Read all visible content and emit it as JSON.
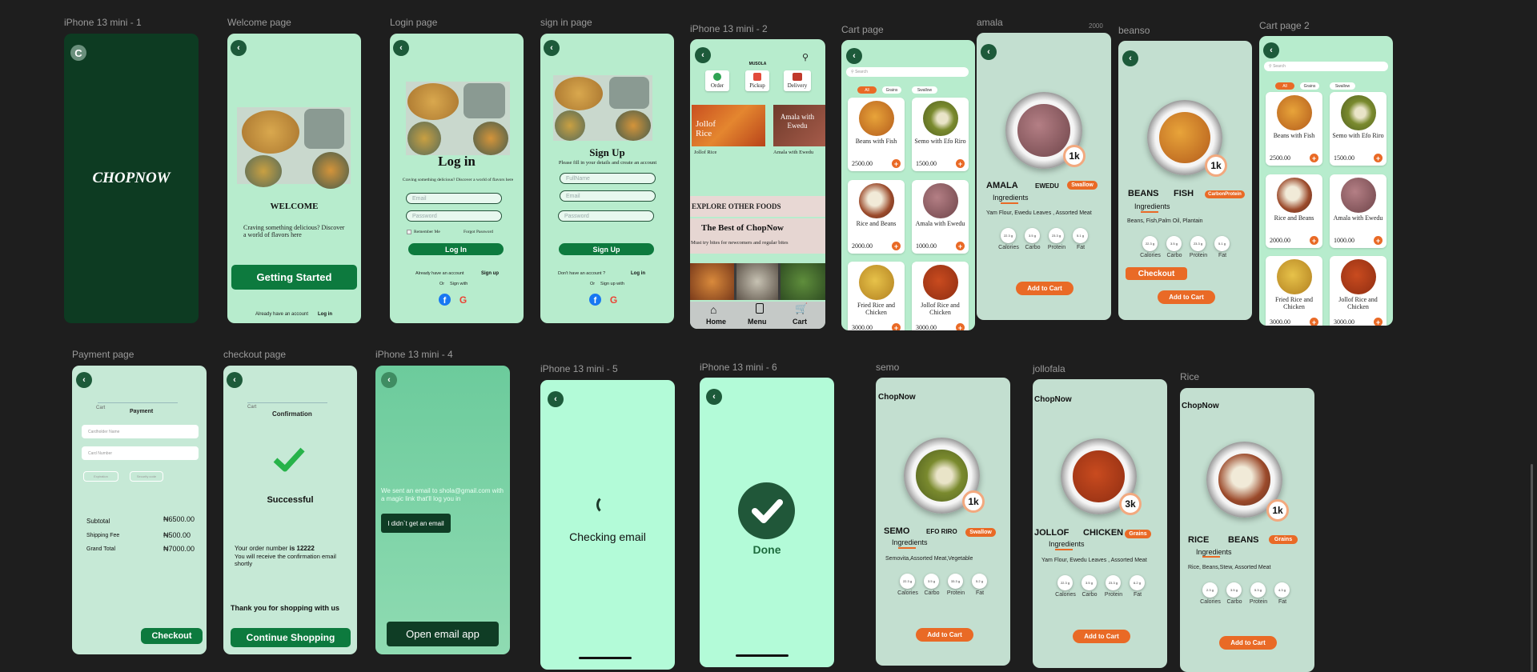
{
  "frames": {
    "splash": {
      "label": "iPhone 13 mini - 1",
      "brand": "CHOPNOW",
      "logo_letter": "C"
    },
    "welcome": {
      "label": "Welcome page",
      "title": "WELCOME",
      "text": "Craving something delicious? Discover a world of flavors  here",
      "cta": "Getting Started",
      "footer_a": "Already have an account",
      "footer_b": "Log in"
    },
    "login": {
      "label": "Login page",
      "title": "Log in",
      "subtitle": "Craving something delicious? Discover a world of flavors here",
      "email_ph": "Email",
      "password_ph": "Password",
      "remember": "Remember Me",
      "forgot": "Forgot Password",
      "button": "Log In",
      "have_account": "Already have an account",
      "signup": "Sign up",
      "or": "Or",
      "sign_with": "Sign with"
    },
    "signin": {
      "label": "sign in page",
      "title": "Sign Up",
      "subtitle": "Please fill in your details and create an account",
      "fullname_ph": "FullName",
      "email_ph": "Email",
      "password_ph": "Password",
      "button": "Sign Up",
      "no_account": "Don't have an account ?",
      "login": "Log in",
      "or": "Or",
      "sign_with": "Sign up with"
    },
    "home": {
      "label": "iPhone 13 mini - 2",
      "brand": "MUSOLA",
      "nav": [
        "Order",
        "Pickup",
        "Delivery"
      ],
      "featured": [
        {
          "name": "Jollof Rice",
          "overlay": "Jollof Rice"
        },
        {
          "name": "Amala with Ewedu",
          "overlay": "Amala with Ewedu"
        }
      ],
      "explore": "EXPLORE OTHER FOODS",
      "best_title": "The Best of ChopNow",
      "best_sub": "Must try bites for newcomers and regular bites",
      "tabs": [
        "Home",
        "Menu",
        "Cart"
      ]
    },
    "cart": {
      "label": "Cart page",
      "search_ph": "Search",
      "chips": [
        "All",
        "Grains",
        "Swallow"
      ],
      "items": [
        {
          "name": "Beans with Fish",
          "price": "2500.00"
        },
        {
          "name": "Semo with Efo Riro",
          "price": "1500.00"
        },
        {
          "name": "Rice and Beans",
          "price": "2000.00"
        },
        {
          "name": "Amala with Ewedu",
          "price": "1000.00"
        },
        {
          "name": "Fried Rice and Chicken",
          "price": "3000.00"
        },
        {
          "name": "Jollof Rice and Chicken",
          "price": "3000.00"
        }
      ]
    },
    "amala": {
      "label": "amala",
      "name_a": "AMALA",
      "name_b": "EWEDU",
      "tag": "Swallow",
      "badge": "1k",
      "ingredients_title": "Ingredients",
      "ingredients": "Yam Flour, Ewedu Leaves , Assorted Meat",
      "nutrition": [
        {
          "label": "Calories",
          "value": "22.3 g"
        },
        {
          "label": "Carbo",
          "value": "3.5 g"
        },
        {
          "label": "Protein",
          "value": "23.3 g"
        },
        {
          "label": "Fat",
          "value": "5.1 g"
        }
      ],
      "button": "Add to Cart",
      "extra": "2000"
    },
    "beanso": {
      "label": "beanso",
      "name_a": "BEANS",
      "name_b": "FISH",
      "tag": "CarbonProtein",
      "badge": "1k",
      "ingredients_title": "Ingredients",
      "ingredients": "Beans, Fish,Palm Oil, Plantain",
      "nutrition": [
        {
          "label": "Calories",
          "value": "22.3 g"
        },
        {
          "label": "Carbo",
          "value": "3.5 g"
        },
        {
          "label": "Protein",
          "value": "23.3 g"
        },
        {
          "label": "Fat",
          "value": "5.1 g"
        }
      ],
      "checkout": "Checkout",
      "button": "Add to Cart"
    },
    "cart2": {
      "label": "Cart page 2",
      "search_ph": "Search",
      "chips": [
        "All",
        "Grains",
        "Swallow"
      ],
      "items": [
        {
          "name": "Beans with Fish",
          "price": "2500.00"
        },
        {
          "name": "Semo with Efo Riro",
          "price": "1500.00"
        },
        {
          "name": "Rice and Beans",
          "price": "2000.00"
        },
        {
          "name": "Amala with Ewedu",
          "price": "1000.00"
        },
        {
          "name": "Fried Rice and Chicken",
          "price": "3000.00"
        },
        {
          "name": "Jollof Rice and Chicken",
          "price": "3000.00"
        }
      ]
    },
    "payment": {
      "label": "Payment page",
      "steps": [
        "Cart",
        "Payment"
      ],
      "cardholder_ph": "Cardholder  Name",
      "cardnum_ph": "Card Number",
      "expiry_ph": "Expiration",
      "cvv_ph": "Security code",
      "subtotal_l": "Subtotal",
      "subtotal_v": "₦6500.00",
      "ship_l": "Shipping Fee",
      "ship_v": "₦500.00",
      "total_l": "Grand Total",
      "total_v": "₦7000.00",
      "button": "Checkout"
    },
    "checkout": {
      "label": "checkout page",
      "steps": [
        "Cart",
        "Confirmation"
      ],
      "status": "Successful",
      "order_pre": "Your order number ",
      "order_num": "is 12222",
      "order_msg": "You will receive the confirmation email shortly",
      "thanks": "Thank you  for shopping with  us",
      "button": "Continue Shopping"
    },
    "mini4": {
      "label": "iPhone 13 mini - 4",
      "message": "We sent an email to shola@gmail.com with a magic link that'll log you in",
      "resend": "I didn`t get an email",
      "open": "Open email app"
    },
    "mini5": {
      "label": "iPhone 13 mini - 5",
      "text": "Checking email"
    },
    "mini6": {
      "label": "iPhone 13 mini - 6",
      "text": "Done"
    },
    "semo": {
      "label": "semo",
      "brand": "ChopNow",
      "name_a": "SEMO",
      "name_b": "EFO RIRO",
      "tag": "Swallow",
      "badge": "1k",
      "ingredients_title": "Ingredients",
      "ingredients": "Semovita,Assorted Meat,Vegetable",
      "nutrition": [
        {
          "label": "Calories",
          "value": "22.3 g"
        },
        {
          "label": "Carbo",
          "value": "3.5 g"
        },
        {
          "label": "Protein",
          "value": "33.3 g"
        },
        {
          "label": "Fat",
          "value": "5.2 g"
        }
      ],
      "button": "Add to Cart"
    },
    "jollofala": {
      "label": "jollofala",
      "brand": "ChopNow",
      "name_a": "JOLLOF",
      "name_b": "CHICKEN",
      "tag": "Grains",
      "badge": "3k",
      "ingredients_title": "Ingredients",
      "ingredients": "Yam Flour, Ewedu Leaves , Assorted Meat",
      "nutrition": [
        {
          "label": "Calories",
          "value": "22.3 g"
        },
        {
          "label": "Carbo",
          "value": "3.5 g"
        },
        {
          "label": "Protein",
          "value": "23.3 g"
        },
        {
          "label": "Fat",
          "value": "6.2 g"
        }
      ],
      "button": "Add to Cart"
    },
    "rice": {
      "label": "Rice",
      "brand": "ChopNow",
      "name_a": "RICE",
      "name_b": "BEANS",
      "tag": "Grains",
      "badge": "1k",
      "ingredients_title": "Ingredients",
      "ingredients": "Rice, Beans,Stew, Assorted Meat",
      "nutrition": [
        {
          "label": "Calories",
          "value": "2.3 g"
        },
        {
          "label": "Carbo",
          "value": "3.5 g"
        },
        {
          "label": "Protein",
          "value": "5.3 g"
        },
        {
          "label": "Fat",
          "value": "4.3 g"
        }
      ],
      "button": "Add to Cart"
    }
  },
  "colors": {
    "canvas": "#1e1e1e",
    "mint": "#b7eccd",
    "dark_green": "#0d3b22",
    "button_green": "#0d7a3e",
    "orange": "#e96a26"
  },
  "icons": [
    "back-arrow-icon",
    "search-icon",
    "home-icon",
    "menu-icon",
    "cart-icon",
    "facebook-icon",
    "google-icon",
    "checkmark-icon",
    "plus-icon"
  ]
}
